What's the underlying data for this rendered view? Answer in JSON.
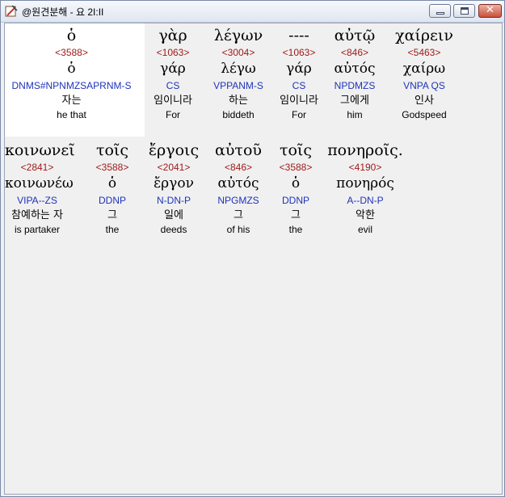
{
  "window": {
    "title": "@원견분해 - 요 2I:II",
    "minimize_icon": "minimize-icon",
    "maximize_icon": "maximize-icon",
    "close_glyph": "✕"
  },
  "words": [
    {
      "greek": "ὁ",
      "strong": "<3588>",
      "lemma": "ὁ",
      "parse": "DNMS#NPNMZSAPRNM-S",
      "korean": "자는",
      "english": "he that"
    },
    {
      "greek": "γὰρ",
      "strong": "<1063>",
      "lemma": "γάρ",
      "parse": "CS",
      "korean": "임이니라",
      "english": "For"
    },
    {
      "greek": "λέγων",
      "strong": "<3004>",
      "lemma": "λέγω",
      "parse": "VPPANM-S",
      "korean": "하는",
      "english": "biddeth"
    },
    {
      "greek": "----",
      "strong": "<1063>",
      "lemma": "γάρ",
      "parse": "CS",
      "korean": "임이니라",
      "english": "For"
    },
    {
      "greek": "αὐτῷ",
      "strong": "<846>",
      "lemma": "αὐτός",
      "parse": "NPDMZS",
      "korean": "그에게",
      "english": "him"
    },
    {
      "greek": "χαίρειν",
      "strong": "<5463>",
      "lemma": "χαίρω",
      "parse": "VNPA QS",
      "korean": "인사",
      "english": "Godspeed"
    },
    {
      "greek": "κοινωνεῖ",
      "strong": "<2841>",
      "lemma": "κοινωνέω",
      "parse": "VIPA--ZS",
      "korean": "참예하는 자",
      "english": "is partaker"
    },
    {
      "greek": "τοῖς",
      "strong": "<3588>",
      "lemma": "ὁ",
      "parse": "DDNP",
      "korean": "그",
      "english": "the"
    },
    {
      "greek": "ἔργοις",
      "strong": "<2041>",
      "lemma": "ἔργον",
      "parse": "N-DN-P",
      "korean": "일에",
      "english": "deeds"
    },
    {
      "greek": "αὐτοῦ",
      "strong": "<846>",
      "lemma": "αὐτός",
      "parse": "NPGMZS",
      "korean": "그",
      "english": "of his"
    },
    {
      "greek": "τοῖς",
      "strong": "<3588>",
      "lemma": "ὁ",
      "parse": "DDNP",
      "korean": "그",
      "english": "the"
    },
    {
      "greek": "πονηροῖς.",
      "strong": "<4190>",
      "lemma": "πονηρός",
      "parse": "A--DN-P",
      "korean": "악한",
      "english": "evil"
    }
  ]
}
